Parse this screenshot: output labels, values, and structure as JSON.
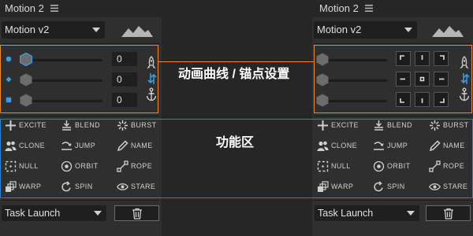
{
  "app": {
    "title": "Motion 2",
    "preset": "Motion v2",
    "bottom_select": "Task Launch"
  },
  "sliders": [
    {
      "value": "0",
      "marker": "circle",
      "color": "#3b9be0"
    },
    {
      "value": "0",
      "marker": "diamond",
      "color": "#3b9be0"
    },
    {
      "value": "0",
      "marker": "square",
      "color": "#3b9be0"
    }
  ],
  "side_icons": [
    "rocket-icon",
    "swap-arrows-icon",
    "anchor-icon"
  ],
  "anchor_grid_icons": [
    "anchor-top-left-icon",
    "anchor-top-center-icon",
    "anchor-top-right-icon",
    "anchor-middle-left-icon",
    "anchor-center-icon",
    "anchor-middle-right-icon",
    "anchor-bottom-left-icon",
    "anchor-bottom-center-icon",
    "anchor-bottom-right-icon"
  ],
  "actions": [
    {
      "label": "EXCITE",
      "icon": "plus-icon"
    },
    {
      "label": "BLEND",
      "icon": "blend-icon"
    },
    {
      "label": "BURST",
      "icon": "burst-icon"
    },
    {
      "label": "CLONE",
      "icon": "clone-icon"
    },
    {
      "label": "JUMP",
      "icon": "jump-icon"
    },
    {
      "label": "NAME",
      "icon": "pencil-icon"
    },
    {
      "label": "NULL",
      "icon": "null-icon"
    },
    {
      "label": "ORBIT",
      "icon": "orbit-icon"
    },
    {
      "label": "ROPE",
      "icon": "rope-icon"
    },
    {
      "label": "WARP",
      "icon": "warp-icon"
    },
    {
      "label": "SPIN",
      "icon": "spin-icon"
    },
    {
      "label": "STARE",
      "icon": "eye-icon"
    }
  ],
  "annotations": {
    "curves_anchor": "动画曲线 / 锚点设置",
    "functions": "功能区"
  },
  "colors": {
    "accent_blue": "#3b9be0",
    "highlight_orange": "#e8892c",
    "highlight_blue": "#2f7fd0",
    "panel_bg": "#2f2f2f",
    "field_bg": "#1f1f1f"
  }
}
